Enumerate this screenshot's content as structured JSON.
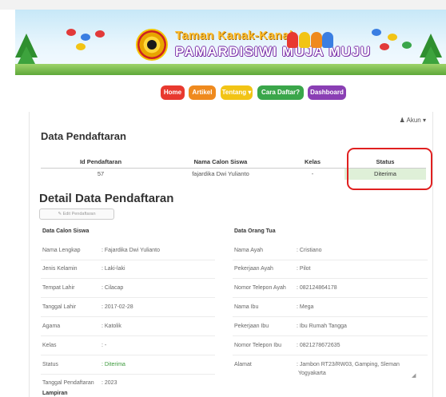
{
  "header": {
    "title_line1": "Taman Kanak-Kanak",
    "title_line2": "PAMARDISIWI MUJA MUJU"
  },
  "nav": {
    "items": [
      "Home",
      "Artikel",
      "Tentang",
      "Cara Daftar?",
      "Dashboard"
    ],
    "colors": [
      "#e8392f",
      "#ef8a1e",
      "#f2c415",
      "#3aa64a",
      "#8a3fb4"
    ]
  },
  "account": {
    "label": "Akun"
  },
  "registration": {
    "title": "Data Pendaftaran",
    "columns": [
      "Id Pendaftaran",
      "Nama Calon Siswa",
      "Kelas",
      "Status"
    ],
    "row": [
      "57",
      "fajardika Dwi Yulianto",
      "-",
      "Diterima"
    ]
  },
  "detail": {
    "title": "Detail Data Pendaftaran",
    "edit_label": "Edit Pendaftaran",
    "student_header": "Data Calon Siswa",
    "parent_header": "Data Orang Tua",
    "student_rows": [
      {
        "label": "Nama Lengkap",
        "value": ": Fajardika Dwi Yulianto"
      },
      {
        "label": "Jenis Kelamin",
        "value": ": Laki-laki"
      },
      {
        "label": "Tempat Lahir",
        "value": ": Cilacap"
      },
      {
        "label": "Tanggal Lahir",
        "value": ": 2017-02-28"
      },
      {
        "label": "Agama",
        "value": ": Katolik"
      },
      {
        "label": "Kelas",
        "value": ": -"
      },
      {
        "label": "Status",
        "value": ": Diterima"
      },
      {
        "label": "Tanggal Pendaftaran",
        "value": ": 2023"
      }
    ],
    "parent_rows": [
      {
        "label": "Nama Ayah",
        "value": ": Cristiano"
      },
      {
        "label": "Pekerjaan Ayah",
        "value": ": Pilot"
      },
      {
        "label": "Nomor Telepon Ayah",
        "value": ": 082124864178"
      },
      {
        "label": "Nama Ibu",
        "value": ": Mega"
      },
      {
        "label": "Pekerjaan Ibu",
        "value": ": Ibu Rumah Tangga"
      },
      {
        "label": "Nomor Telepon Ibu",
        "value": ": 0821278672635"
      },
      {
        "label": "Alamat",
        "value": ": Jambon RT23/RW03, Gamping, Sleman"
      },
      {
        "label": "",
        "value": "Yogyakarta"
      }
    ],
    "attachment_header": "Lampiran"
  }
}
